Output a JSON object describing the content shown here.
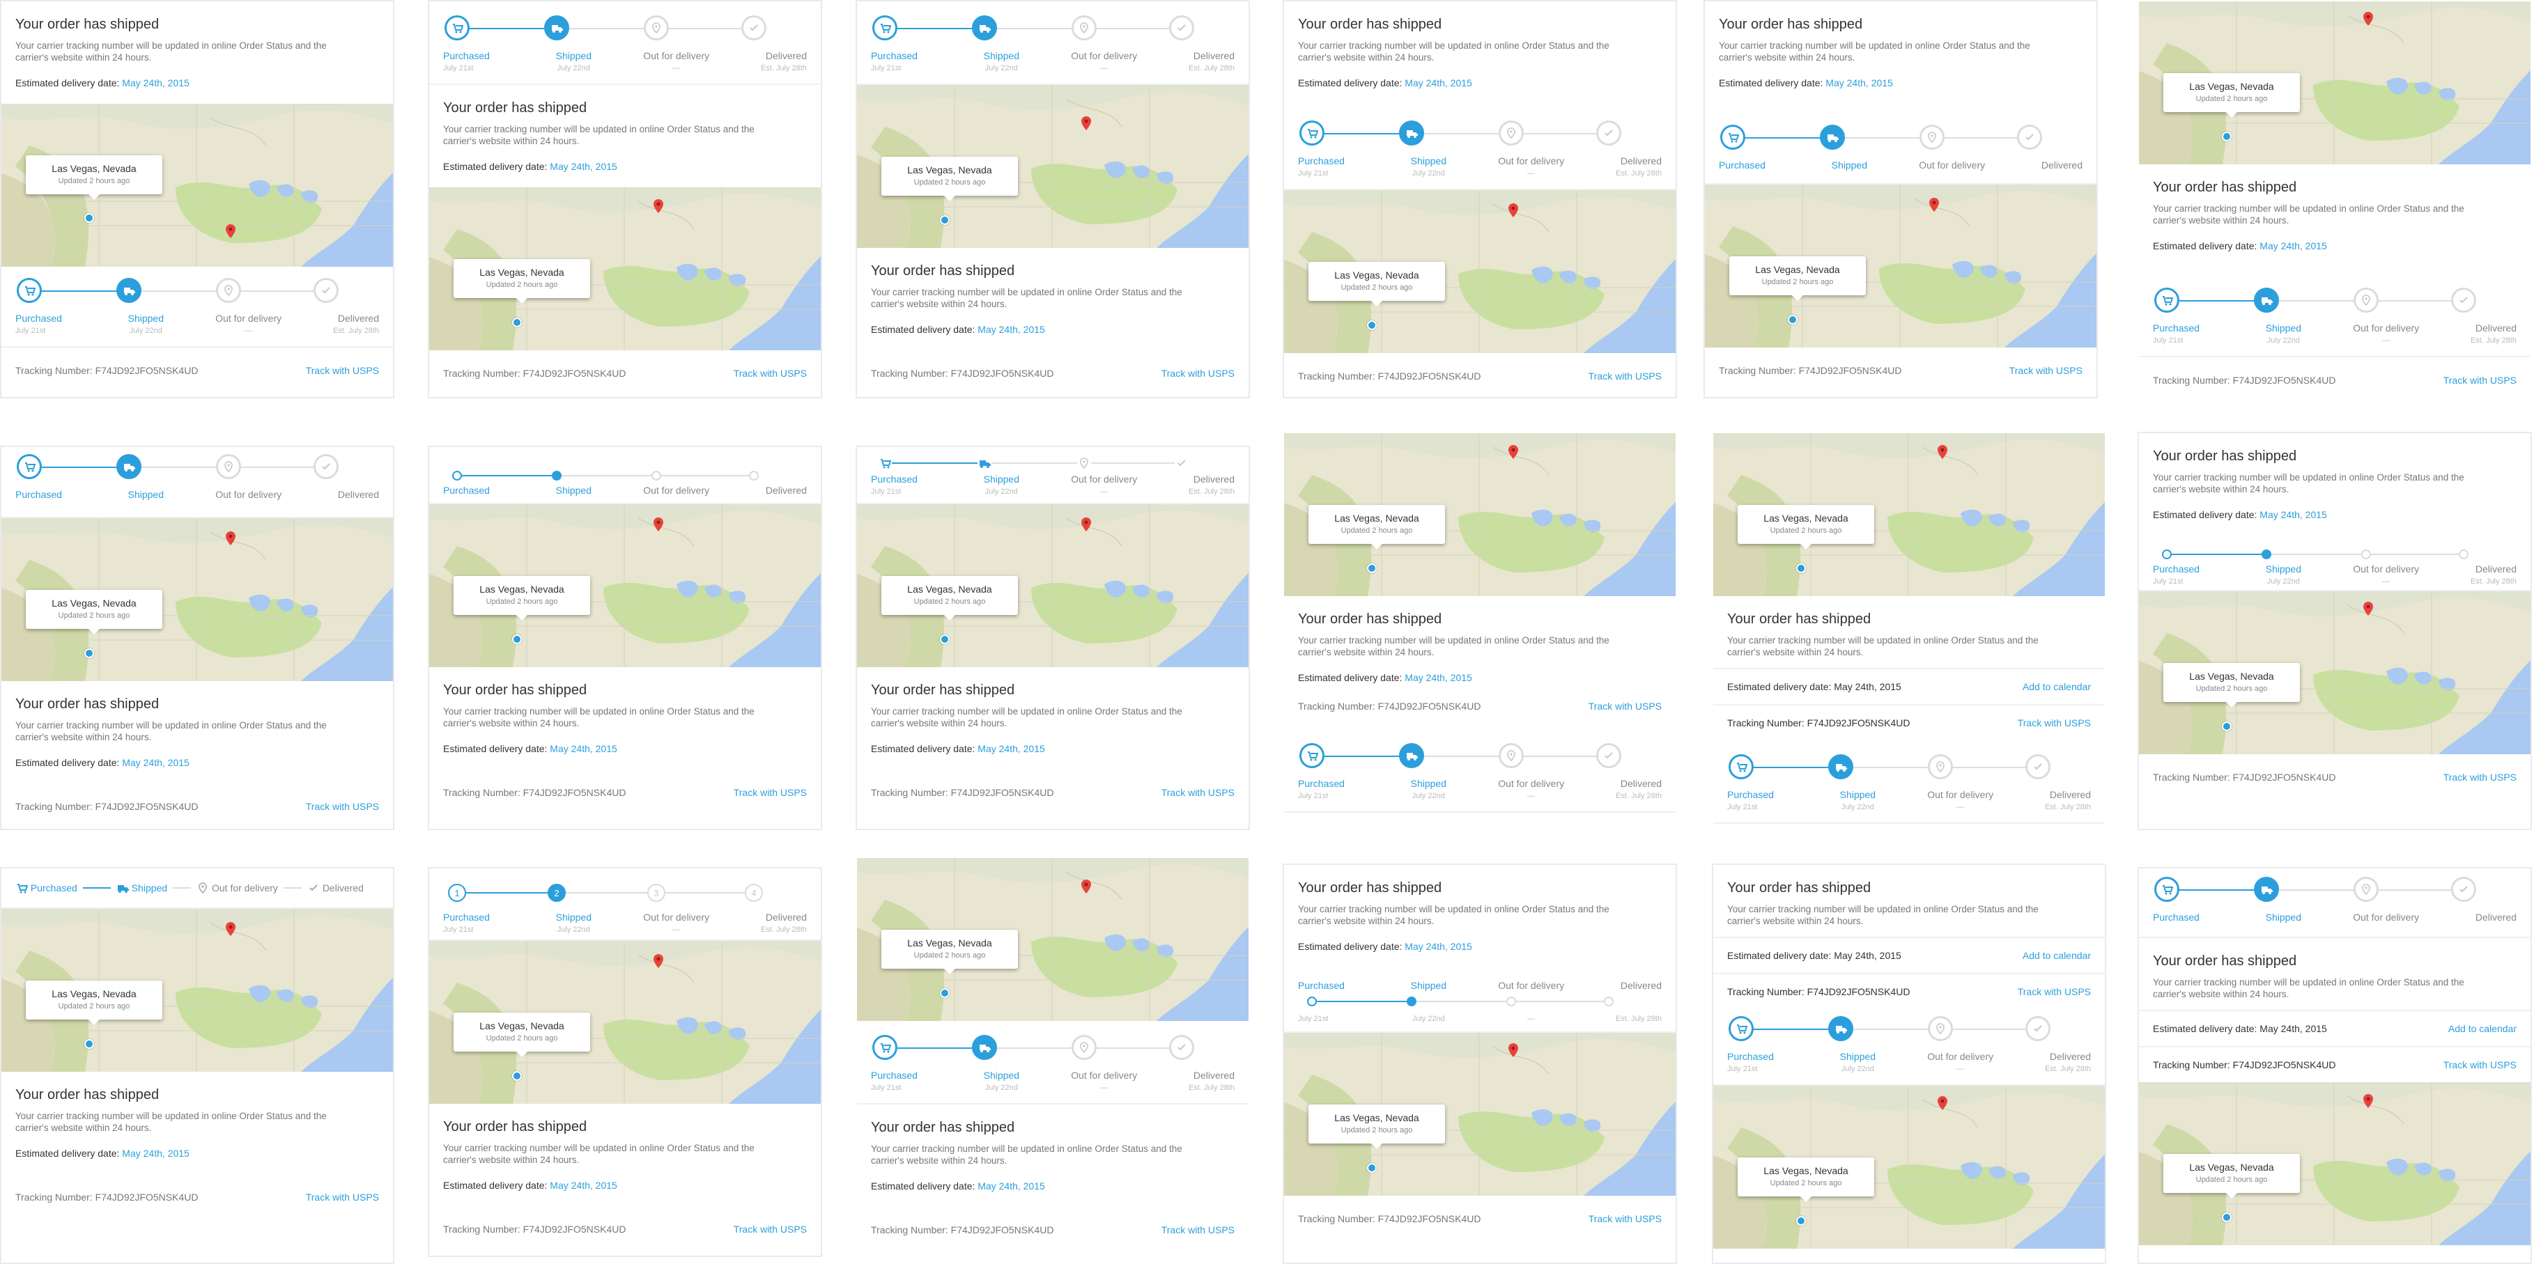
{
  "order": {
    "title": "Your order has shipped",
    "subtitle": "Your carrier tracking number will be updated in online Order Status and the carrier's website within 24 hours.",
    "delivery_label": "Estimated delivery date:",
    "delivery_value": "May 24th, 2015",
    "tracking_label": "Tracking Number:",
    "tracking_value": "F74JD92JFO5NSK4UD",
    "track_link": "Track with USPS",
    "calendar_link": "Add to calendar"
  },
  "map": {
    "city": "Las Vegas, Nevada",
    "updated": "Updated 2 hours ago"
  },
  "steps": [
    {
      "label": "Purchased",
      "date": "July 21st",
      "icon": "cart-icon",
      "state": "done"
    },
    {
      "label": "Shipped",
      "date": "July 22nd",
      "icon": "truck-icon",
      "state": "current"
    },
    {
      "label": "Out for delivery",
      "date": "—",
      "icon": "location-pin-icon",
      "state": "pending"
    },
    {
      "label": "Delivered",
      "date": "Est. July 28th",
      "icon": "check-icon",
      "state": "pending"
    }
  ],
  "numbers": [
    "1",
    "2",
    "3",
    "4"
  ],
  "colors": {
    "accent": "#2b9fdc",
    "pin": "#e8423a",
    "land": "#e8e6d0",
    "water": "#a9c8f2"
  }
}
